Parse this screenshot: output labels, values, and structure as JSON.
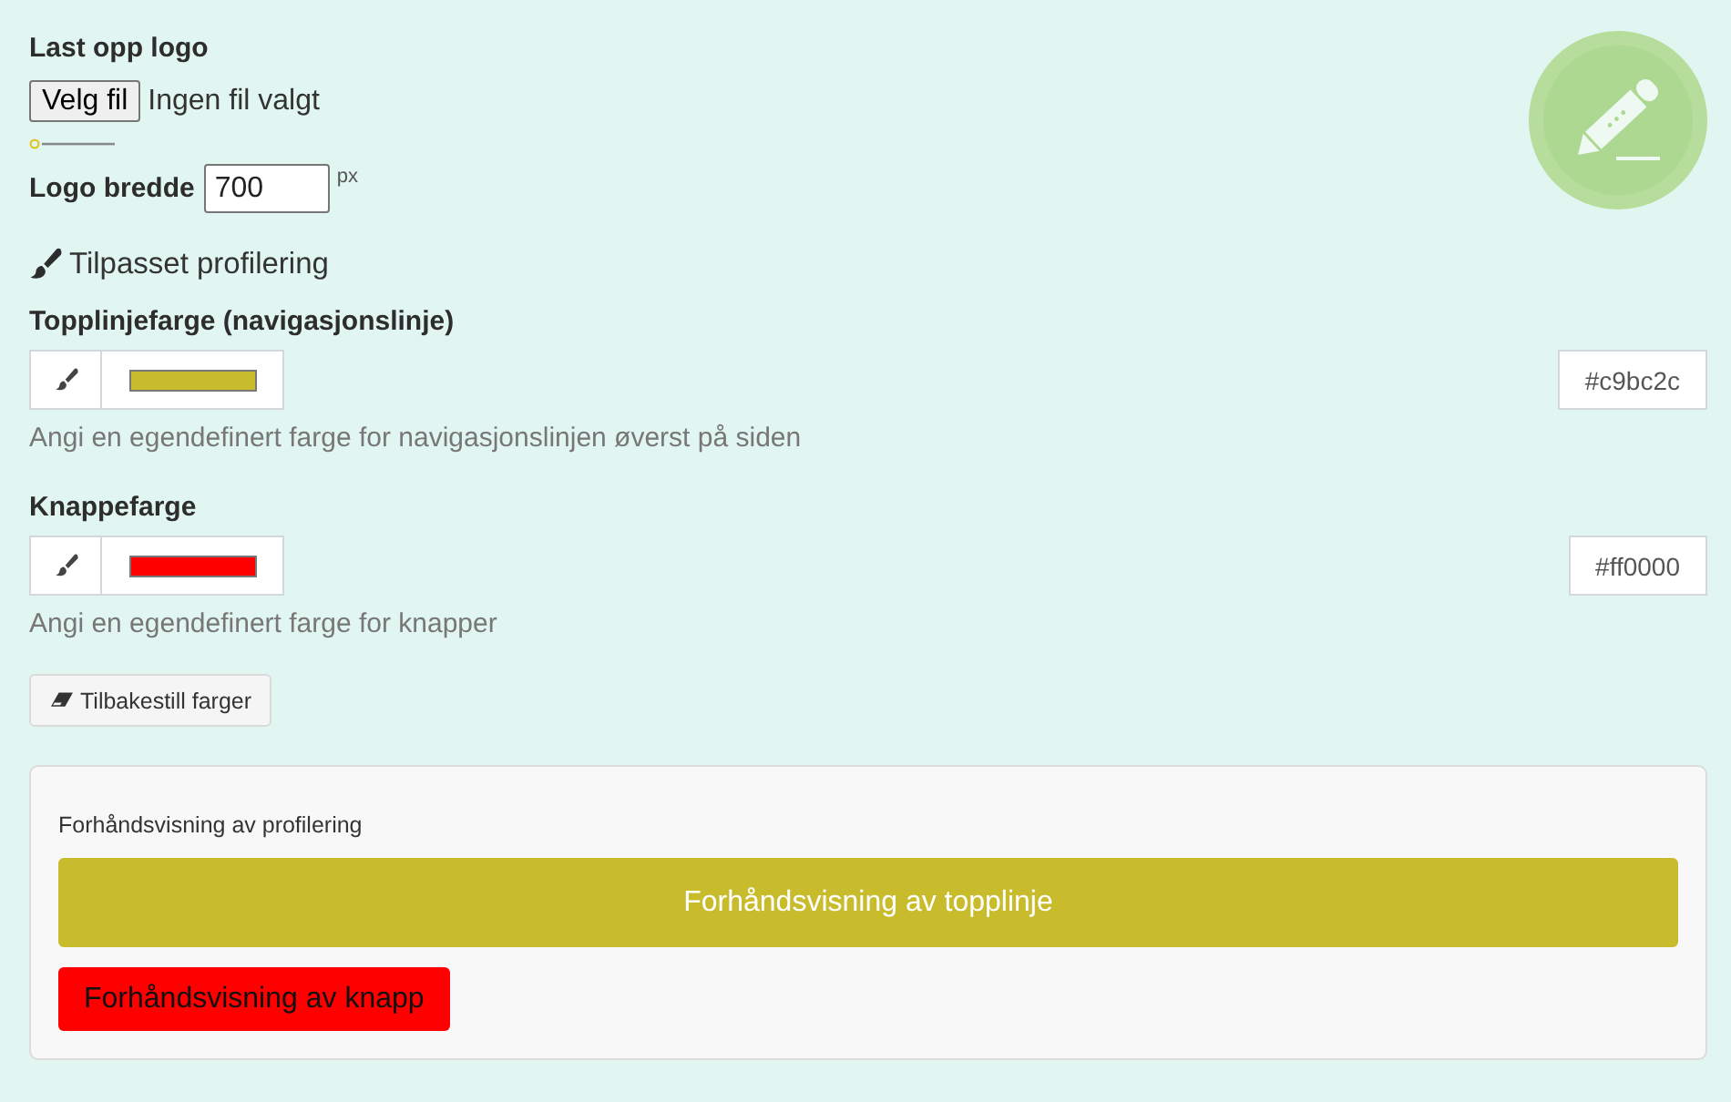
{
  "logo_upload": {
    "label": "Last opp logo",
    "file_button": "Velg fil",
    "file_status": "Ingen fil valgt"
  },
  "logo_width": {
    "label": "Logo bredde",
    "value": "700",
    "unit": "px"
  },
  "section_title": "Tilpasset profilering",
  "color_fields": [
    {
      "label": "Topplinjefarge (navigasjonslinje)",
      "color": "#c9bc2c",
      "value": "#c9bc2c",
      "help": "Angi en egendefinert farge for navigasjonslinjen øverst på siden"
    },
    {
      "label": "Knappefarge",
      "color": "#ff0000",
      "value": "#ff0000",
      "help": "Angi en egendefinert farge for knapper"
    }
  ],
  "reset_button": "Tilbakestill farger",
  "preview": {
    "title": "Forhåndsvisning av profilering",
    "topbar_label": "Forhåndsvisning av topplinje",
    "button_label": "Forhåndsvisning av knapp"
  }
}
